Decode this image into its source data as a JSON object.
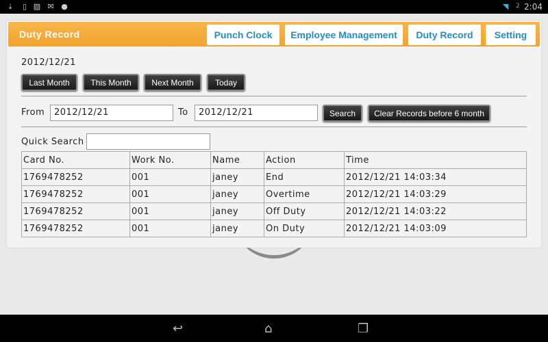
{
  "status_bar": {
    "time": "2:04",
    "battery": "2"
  },
  "header": {
    "title": "Duty Record",
    "tabs": [
      "Punch Clock",
      "Employee Management",
      "Duty Record",
      "Setting"
    ]
  },
  "current_date": "2012/12/21",
  "nav_buttons": [
    "Last Month",
    "This Month",
    "Next Month",
    "Today"
  ],
  "filter": {
    "from_label": "From",
    "from_value": "2012/12/21",
    "to_label": "To",
    "to_value": "2012/12/21",
    "search": "Search",
    "clear": "Clear Records before 6 month"
  },
  "quick_search": {
    "label": "Quick Search",
    "value": ""
  },
  "table": {
    "headers": [
      "Card No.",
      "Work No.",
      "Name",
      "Action",
      "Time"
    ],
    "rows": [
      [
        "1769478252",
        "001",
        "janey",
        "End",
        "2012/12/21 14:03:34"
      ],
      [
        "1769478252",
        "001",
        "janey",
        "Overtime",
        "2012/12/21 14:03:29"
      ],
      [
        "1769478252",
        "001",
        "janey",
        "Off Duty",
        "2012/12/21 14:03:22"
      ],
      [
        "1769478252",
        "001",
        "janey",
        "On Duty",
        "2012/12/21 14:03:09"
      ]
    ]
  }
}
